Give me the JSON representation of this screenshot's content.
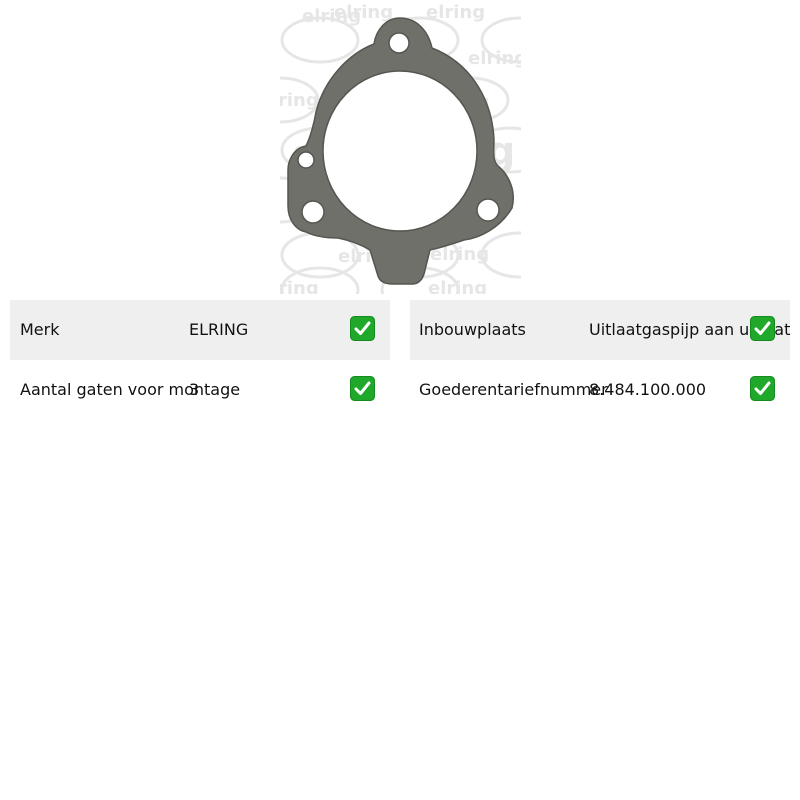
{
  "product_image": {
    "alt": "elring exhaust gasket",
    "watermark_text": "elring",
    "gasket_color": "#6f706a",
    "icon": "gasket-image"
  },
  "specs": {
    "left": [
      {
        "label": "Merk",
        "value": "ELRING",
        "check_icon": "check-mark-icon"
      },
      {
        "label": "Aantal gaten voor montage",
        "value": "3",
        "check_icon": "check-mark-icon"
      }
    ],
    "right": [
      {
        "label": "Inbouwplaats",
        "value": "Uitlaatgaspijp aan uitlaatgasturbocharger",
        "check_icon": "check-mark-icon"
      },
      {
        "label": "Goederentariefnummer",
        "value": "8.484.100.000",
        "check_icon": "check-mark-icon"
      }
    ]
  },
  "colors": {
    "row_shade": "#efefef",
    "check_green": "#1fa82a"
  }
}
